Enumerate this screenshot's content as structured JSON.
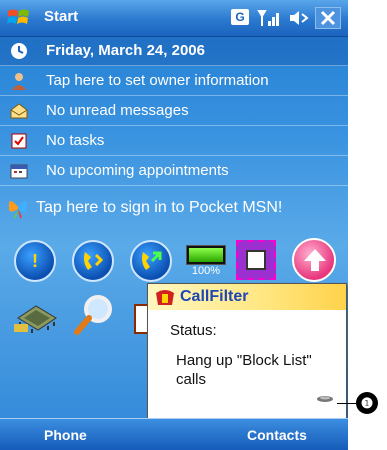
{
  "titlebar": {
    "title": "Start",
    "sync_label": "G"
  },
  "today": {
    "date": "Friday, March 24, 2006",
    "owner": "Tap here to set owner information",
    "messages": "No unread messages",
    "tasks": "No tasks",
    "appointments": "No upcoming appointments",
    "msn": "Tap here to sign in to Pocket MSN!"
  },
  "quicklaunch": {
    "phone1": "!",
    "battery_level": 1.0,
    "battery_label": "100%"
  },
  "popup": {
    "title": "CallFilter",
    "status": "Status:",
    "message": "Hang up \"Block List\" calls"
  },
  "callout": {
    "marker": "❶"
  },
  "softkeys": {
    "left": "Phone",
    "right": "Contacts"
  },
  "colors": {
    "accent": "#1f7bd0",
    "softkey_bar": "#145ab8",
    "popup_title": "#1e46b4"
  }
}
